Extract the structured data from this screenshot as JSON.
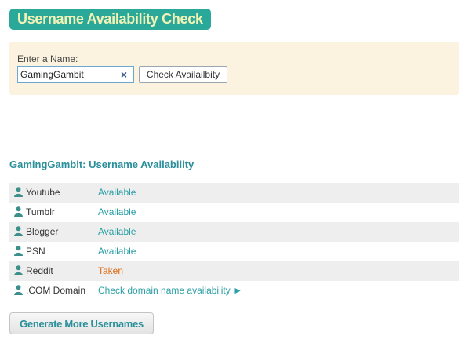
{
  "header": {
    "title": "Username Availability Check"
  },
  "form": {
    "label": "Enter a Name:",
    "input_value": "GamingGambit",
    "clear_icon": "×",
    "check_button_label": "Check Availailbity"
  },
  "results": {
    "heading": "GamingGambit: Username Availability",
    "rows": [
      {
        "site": "Youtube",
        "status": "Available",
        "kind": "available"
      },
      {
        "site": "Tumblr",
        "status": "Available",
        "kind": "available"
      },
      {
        "site": "Blogger",
        "status": "Available",
        "kind": "available"
      },
      {
        "site": "PSN",
        "status": "Available",
        "kind": "available"
      },
      {
        "site": "Reddit",
        "status": "Taken",
        "kind": "taken"
      },
      {
        "site": ".COM Domain",
        "status": "Check domain name availability ►",
        "kind": "link"
      }
    ]
  },
  "footer": {
    "generate_button_label": "Generate More Usernames"
  },
  "colors": {
    "accent": "#2aa99a",
    "title_text": "#f4f3b6",
    "panel_bg": "#fbf3df",
    "available": "#2a9fa5",
    "taken": "#e06a14",
    "user_icon": "#3d8f8c"
  },
  "icons": {
    "row_icon": "user-icon",
    "clear": "close-icon"
  }
}
